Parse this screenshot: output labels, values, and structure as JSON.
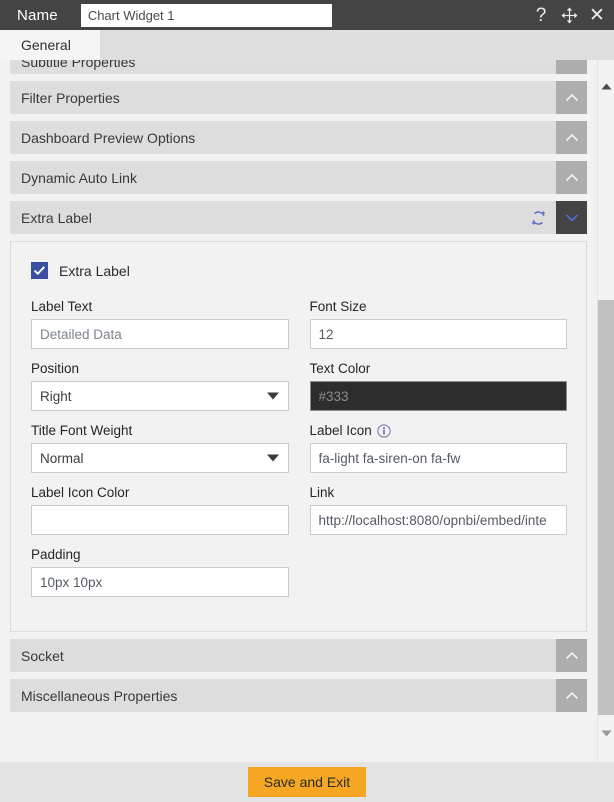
{
  "titlebar": {
    "name_label": "Name",
    "name_value": "Chart Widget 1",
    "help_icon": "?",
    "move_icon": "move-icon",
    "close_icon": "✕"
  },
  "tabs": [
    {
      "label": "General",
      "active": true
    }
  ],
  "sections": [
    {
      "label": "Subtitle Properties",
      "expanded": false,
      "clipped": true
    },
    {
      "label": "Filter Properties",
      "expanded": false
    },
    {
      "label": "Dashboard Preview Options",
      "expanded": false
    },
    {
      "label": "Dynamic Auto Link",
      "expanded": false
    },
    {
      "label": "Extra Label",
      "expanded": true,
      "has_refresh": true
    }
  ],
  "extra_label_panel": {
    "checkbox": {
      "label": "Extra Label",
      "checked": true
    },
    "fields": [
      {
        "label": "Label Text",
        "type": "text",
        "value": "Detailed Data",
        "muted": true
      },
      {
        "label": "Font Size",
        "type": "text",
        "value": "12"
      },
      {
        "label": "Position",
        "type": "select",
        "value": "Right"
      },
      {
        "label": "Text Color",
        "type": "color",
        "value": "#333"
      },
      {
        "label": "Title Font Weight",
        "type": "select",
        "value": "Normal"
      },
      {
        "label": "Label Icon",
        "type": "text",
        "value": "fa-light fa-siren-on fa-fw",
        "info": true
      },
      {
        "label": "Label Icon Color",
        "type": "text",
        "value": ""
      },
      {
        "label": "Link",
        "type": "text",
        "value": "http://localhost:8080/opnbi/embed/inte"
      },
      {
        "label": "Padding",
        "type": "text",
        "value": "10px 10px"
      }
    ]
  },
  "bottom_sections": [
    {
      "label": "Socket",
      "expanded": false
    },
    {
      "label": "Miscellaneous Properties",
      "expanded": false
    }
  ],
  "footer": {
    "save_label": "Save and Exit"
  },
  "colors": {
    "titlebar_bg": "#444444",
    "accent_checkbox": "#3b4fa0",
    "accent_chevron": "#4a6fd0",
    "save_button": "#f5a623",
    "text_color_swatch": "#2d2d2d"
  }
}
